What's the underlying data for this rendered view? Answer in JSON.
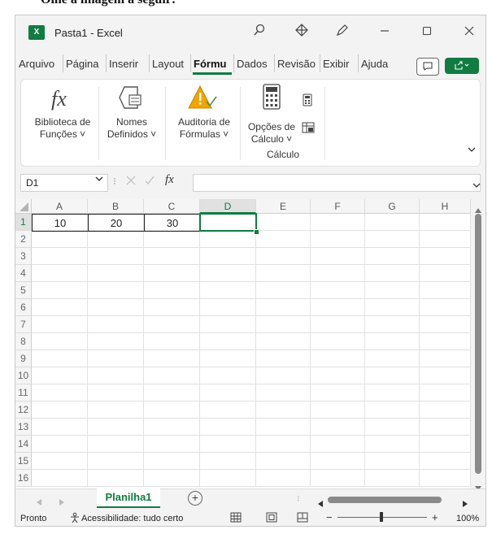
{
  "caption_fragment": "Olhe a imagem a seguir:",
  "window": {
    "title": "Pasta1 - Excel",
    "app_icon": "X"
  },
  "ribbon_tabs": [
    "Arquivo",
    "Página",
    "Inserir",
    "Layout",
    "Fórmu",
    "Dados",
    "Revisão",
    "Exibir",
    "Ajuda"
  ],
  "active_tab": "Fórmu",
  "ribbon": {
    "function_library": {
      "line1": "Biblioteca de",
      "line2": "Funções ˅"
    },
    "defined_names": {
      "line1": "Nomes",
      "line2": "Definidos ˅"
    },
    "formula_auditing": {
      "line1": "Auditoria de",
      "line2": "Fórmulas ˅"
    },
    "calc_options": {
      "line1": "Opções de",
      "line2": "Cálculo ˅"
    },
    "calc_group_label": "Cálculo"
  },
  "name_box": {
    "value": "D1"
  },
  "formula_bar": {
    "fx": "fx",
    "value": ""
  },
  "columns": [
    "A",
    "B",
    "C",
    "D",
    "E",
    "F",
    "G",
    "H"
  ],
  "rows": [
    "1",
    "2",
    "3",
    "4",
    "5",
    "6",
    "7",
    "8",
    "9",
    "10",
    "11",
    "12",
    "13",
    "14",
    "15",
    "16"
  ],
  "cells": {
    "A1": "10",
    "B1": "20",
    "C1": "30"
  },
  "selected_cell": "D1",
  "sheet_tab": "Planilha1",
  "add_sheet": "+",
  "status": {
    "ready": "Pronto",
    "accessibility": "Acessibilidade: tudo certo",
    "zoom": "100%"
  },
  "colors": {
    "excel_green": "#107c41",
    "accent_orange": "#f0a500"
  }
}
